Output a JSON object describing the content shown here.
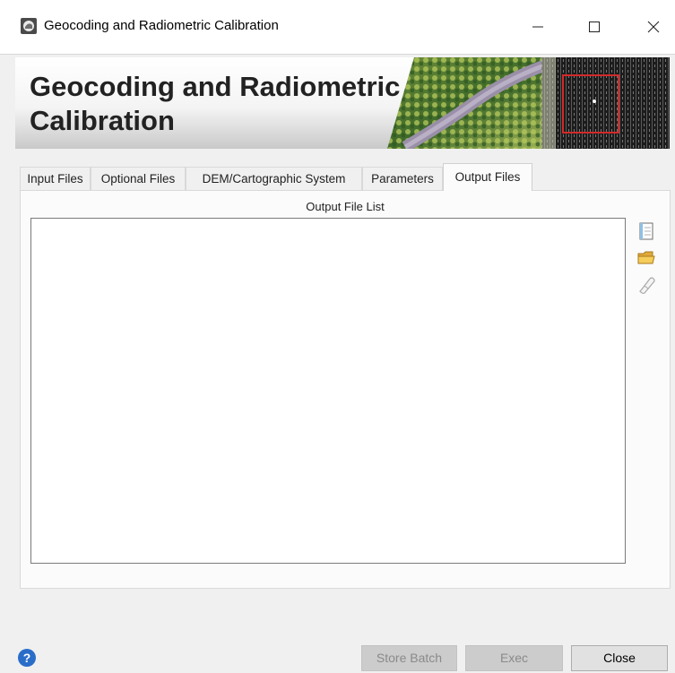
{
  "window": {
    "title": "Geocoding and Radiometric Calibration"
  },
  "banner": {
    "title": "Geocoding and Radiometric\nCalibration"
  },
  "tabs": [
    {
      "label": "Input Files",
      "active": false
    },
    {
      "label": "Optional Files",
      "active": false
    },
    {
      "label": "DEM/Cartographic System",
      "active": false
    },
    {
      "label": "Parameters",
      "active": false
    },
    {
      "label": "Output Files",
      "active": true
    }
  ],
  "output_panel": {
    "list_label": "Output File List",
    "items": []
  },
  "side_toolbar": {
    "icons": [
      "new-file-icon",
      "open-folder-icon",
      "clear-eraser-icon"
    ]
  },
  "footer": {
    "help_icon": "help-icon",
    "help_glyph": "?",
    "buttons": {
      "store_batch": "Store Batch",
      "exec": "Exec",
      "close": "Close"
    }
  },
  "colors": {
    "help_blue": "#2a6dc9",
    "selection_red": "#d22a2a",
    "disabled_button": "#cccccc"
  }
}
